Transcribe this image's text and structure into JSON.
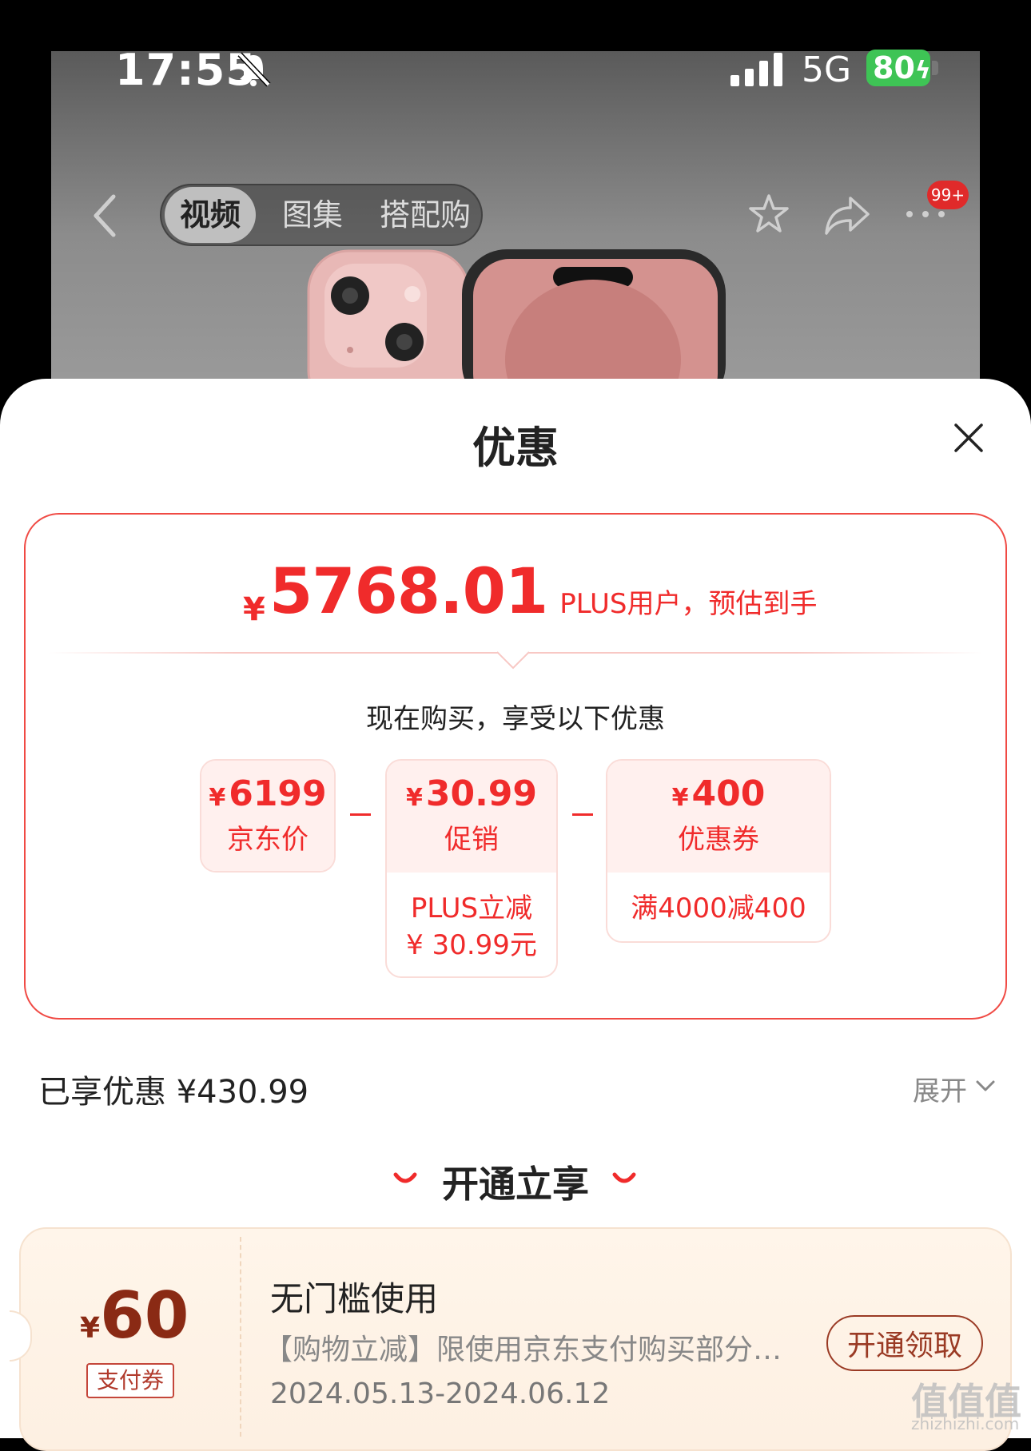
{
  "status_bar": {
    "time": "17:55",
    "network": "5G",
    "battery": "80"
  },
  "nav": {
    "tabs": [
      {
        "label": "视频",
        "active": true
      },
      {
        "label": "图集",
        "active": false
      },
      {
        "label": "搭配购",
        "active": false
      }
    ],
    "badge": "99+"
  },
  "sheet": {
    "title": "优惠",
    "estimate": {
      "currency": "¥",
      "price": "5768.01",
      "note": "PLUS用户，预估到手"
    },
    "subtitle": "现在购买，享受以下优惠",
    "breakdown": [
      {
        "currency": "¥",
        "amount": "6199",
        "label": "京东价",
        "detail": ""
      },
      {
        "currency": "¥",
        "amount": "30.99",
        "label": "促销",
        "detail_line1": "PLUS立减",
        "detail_line2": "¥ 30.99元"
      },
      {
        "currency": "¥",
        "amount": "400",
        "label": "优惠券",
        "detail_line1": "满4000减400"
      }
    ],
    "enjoyed": "已享优惠 ¥430.99",
    "expand_label": "展开",
    "open_section_title": "开通立享",
    "coupon": {
      "currency": "¥",
      "amount": "60",
      "tag": "支付券",
      "title": "无门槛使用",
      "description": "【购物立减】限使用京东支付购买部分…",
      "date_range": "2024.05.13-2024.06.12",
      "button": "开通领取"
    }
  },
  "colors": {
    "accent_red": "#f02b2b",
    "coupon_brown": "#8a2a14",
    "battery_green": "#3ec455"
  }
}
